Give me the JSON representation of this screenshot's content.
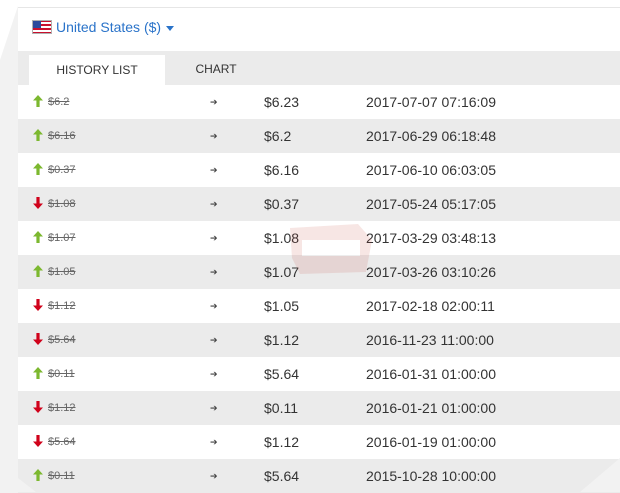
{
  "currency_selector": {
    "label": "United States ($)",
    "flag_icon": "us-flag-icon"
  },
  "tabs": [
    {
      "label": "HISTORY LIST",
      "active": true
    },
    {
      "label": "CHART",
      "active": false
    }
  ],
  "colors": {
    "accent": "#2a73c9",
    "up": "#7cb82f",
    "down": "#d0021b"
  },
  "arrow_glyph": "➔",
  "history": [
    {
      "direction": "up",
      "old": "$6.2",
      "new": "$6.23",
      "date": "2017-07-07 07:16:09"
    },
    {
      "direction": "up",
      "old": "$6.16",
      "new": "$6.2",
      "date": "2017-06-29 06:18:48"
    },
    {
      "direction": "up",
      "old": "$0.37",
      "new": "$6.16",
      "date": "2017-06-10 06:03:05"
    },
    {
      "direction": "down",
      "old": "$1.08",
      "new": "$0.37",
      "date": "2017-05-24 05:17:05"
    },
    {
      "direction": "up",
      "old": "$1.07",
      "new": "$1.08",
      "date": "2017-03-29 03:48:13"
    },
    {
      "direction": "up",
      "old": "$1.05",
      "new": "$1.07",
      "date": "2017-03-26 03:10:26"
    },
    {
      "direction": "down",
      "old": "$1.12",
      "new": "$1.05",
      "date": "2017-02-18 02:00:11"
    },
    {
      "direction": "down",
      "old": "$5.64",
      "new": "$1.12",
      "date": "2016-11-23 11:00:00"
    },
    {
      "direction": "up",
      "old": "$0.11",
      "new": "$5.64",
      "date": "2016-01-31 01:00:00"
    },
    {
      "direction": "down",
      "old": "$1.12",
      "new": "$0.11",
      "date": "2016-01-21 01:00:00"
    },
    {
      "direction": "down",
      "old": "$5.64",
      "new": "$1.12",
      "date": "2016-01-19 01:00:00"
    },
    {
      "direction": "up",
      "old": "$0.11",
      "new": "$5.64",
      "date": "2015-10-28 10:00:00"
    }
  ]
}
